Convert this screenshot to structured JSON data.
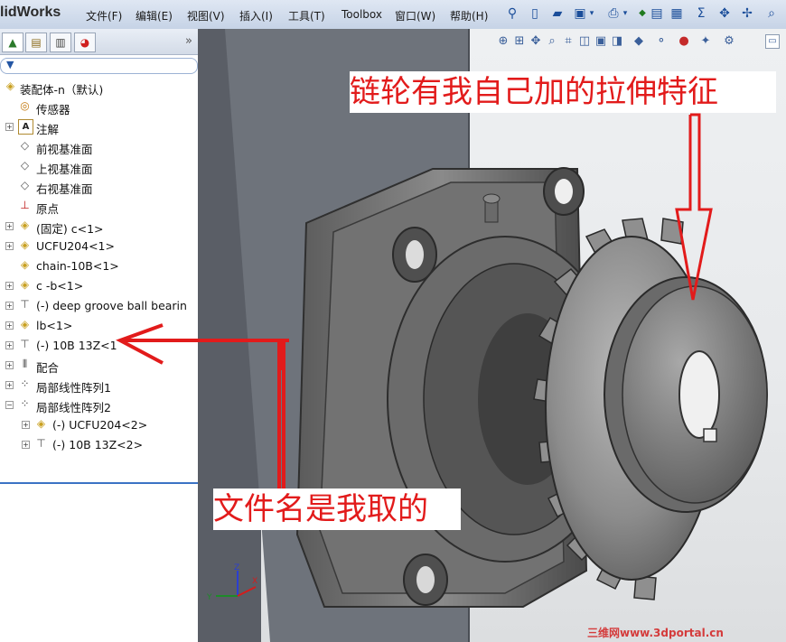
{
  "app": {
    "title": "lidWorks"
  },
  "menu": {
    "items": [
      "文件(F)",
      "编辑(E)",
      "视图(V)",
      "插入(I)",
      "工具(T)",
      "Toolbox",
      "窗口(W)",
      "帮助(H)"
    ]
  },
  "panel": {
    "chevron": "»"
  },
  "tree": {
    "items": [
      {
        "label": "装配体-n（默认)",
        "icon": "assembly-icon"
      },
      {
        "label": "传感器",
        "icon": "sensor-icon"
      },
      {
        "label": "注解",
        "icon": "annotation-icon"
      },
      {
        "label": "前视基准面",
        "icon": "plane-icon"
      },
      {
        "label": "上视基准面",
        "icon": "plane-icon"
      },
      {
        "label": "右视基准面",
        "icon": "plane-icon"
      },
      {
        "label": "原点",
        "icon": "origin-icon"
      },
      {
        "label": "(固定) c<1>",
        "icon": "part-icon"
      },
      {
        "label": "UCFU204<1>",
        "icon": "part-icon"
      },
      {
        "label": "chain-10B<1>",
        "icon": "part-icon"
      },
      {
        "label": "c -b<1>",
        "icon": "part-icon"
      },
      {
        "label": "(-) deep groove ball bearin",
        "icon": "toolbox-part-icon"
      },
      {
        "label": "lb<1>",
        "icon": "part-icon"
      },
      {
        "label": "(-) 10B 13Z<1",
        "icon": "toolbox-part-icon"
      },
      {
        "label": "配合",
        "icon": "mates-icon"
      },
      {
        "label": "局部线性阵列1",
        "icon": "pattern-icon"
      },
      {
        "label": "局部线性阵列2",
        "icon": "pattern-icon"
      },
      {
        "label": "(-) UCFU204<2>",
        "icon": "part-icon"
      },
      {
        "label": "(-) 10B 13Z<2>",
        "icon": "toolbox-part-icon"
      }
    ]
  },
  "annotations": {
    "top": "链轮有我自己加的拉伸特征",
    "bottom": "文件名是我取的"
  },
  "triad": {
    "x": "X",
    "y": "Y",
    "z": "Z"
  },
  "watermark": "三维网www.3dportal.cn",
  "colors": {
    "annotation": "#e21b1b",
    "selection": "#3b73c4"
  }
}
